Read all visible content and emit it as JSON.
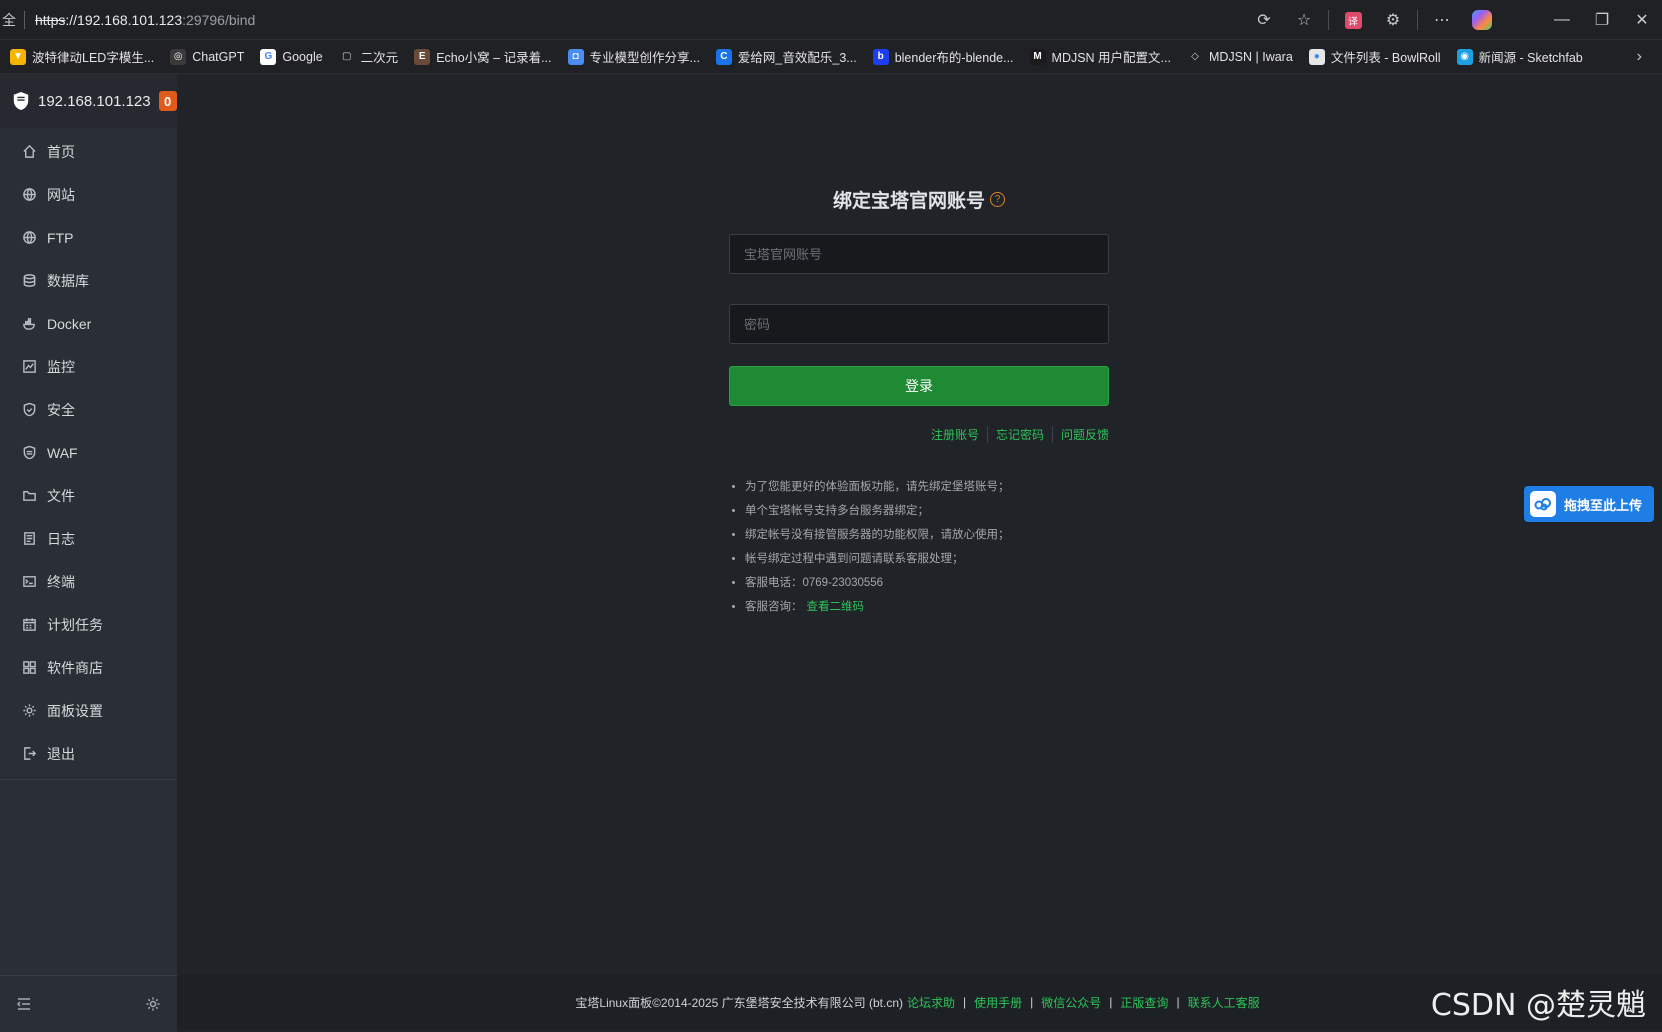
{
  "browser": {
    "url_prefix": "全",
    "url_protocol": "https",
    "url_host": "://192.168.101.123",
    "url_path": ":29796/bind",
    "bookmarks": [
      {
        "label": "波特律动LED字模生...",
        "icon_color": "#f4b400",
        "icon_text": "▼"
      },
      {
        "label": "ChatGPT",
        "icon_color": "#3a3a3a",
        "icon_text": "◎"
      },
      {
        "label": "Google",
        "icon_color": "#ffffff",
        "icon_text": "G"
      },
      {
        "label": "二次元",
        "icon_color": "transparent",
        "icon_text": "▢"
      },
      {
        "label": "Echo小窝 – 记录着...",
        "icon_color": "#6b4a3a",
        "icon_text": "E"
      },
      {
        "label": "专业模型创作分享...",
        "icon_color": "#4a8cf0",
        "icon_text": "◘"
      },
      {
        "label": "爱给网_音效配乐_3...",
        "icon_color": "#1a73e8",
        "icon_text": "C"
      },
      {
        "label": "blender布的-blende...",
        "icon_color": "#1e3cf0",
        "icon_text": "b"
      },
      {
        "label": "MDJSN 用户配置文...",
        "icon_color": "#1b1b1b",
        "icon_text": "M"
      },
      {
        "label": "MDJSN | Iwara",
        "icon_color": "transparent",
        "icon_text": "◇"
      },
      {
        "label": "文件列表 - BowlRoll",
        "icon_color": "#e6e6e6",
        "icon_text": "●"
      },
      {
        "label": "新闻源 - Sketchfab",
        "icon_color": "#1ca0e0",
        "icon_text": "◉"
      }
    ]
  },
  "sidebar": {
    "server_ip": "192.168.101.123",
    "badge_count": "0",
    "items": [
      {
        "label": "首页",
        "name": "home"
      },
      {
        "label": "网站",
        "name": "website"
      },
      {
        "label": "FTP",
        "name": "ftp"
      },
      {
        "label": "数据库",
        "name": "database"
      },
      {
        "label": "Docker",
        "name": "docker"
      },
      {
        "label": "监控",
        "name": "monitor"
      },
      {
        "label": "安全",
        "name": "security"
      },
      {
        "label": "WAF",
        "name": "waf"
      },
      {
        "label": "文件",
        "name": "files"
      },
      {
        "label": "日志",
        "name": "logs"
      },
      {
        "label": "终端",
        "name": "terminal"
      },
      {
        "label": "计划任务",
        "name": "cron"
      },
      {
        "label": "软件商店",
        "name": "store"
      },
      {
        "label": "面板设置",
        "name": "settings"
      },
      {
        "label": "退出",
        "name": "logout"
      }
    ]
  },
  "bind": {
    "title": "绑定宝塔官网账号",
    "help_glyph": "?",
    "account_placeholder": "宝塔官网账号",
    "password_placeholder": "密码",
    "login_label": "登录",
    "links": [
      "注册账号",
      "忘记密码",
      "问题反馈"
    ],
    "notes": [
      "为了您能更好的体验面板功能，请先绑定堡塔账号；",
      "单个宝塔帐号支持多台服务器绑定；",
      "绑定帐号没有接管服务器的功能权限，请放心使用；",
      "帐号绑定过程中遇到问题请联系客服处理；",
      "客服电话：0769-23030556"
    ],
    "consult_prefix": "客服咨询：",
    "consult_link": "查看二维码"
  },
  "upload_tab": {
    "label": "拖拽至此上传"
  },
  "footer": {
    "copyright": "宝塔Linux面板©2014-2025 广东堡塔安全技术有限公司 (bt.cn)",
    "links": [
      "论坛求助",
      "使用手册",
      "微信公众号",
      "正版查询",
      "联系人工客服"
    ]
  },
  "watermark": "CSDN @楚灵魈"
}
